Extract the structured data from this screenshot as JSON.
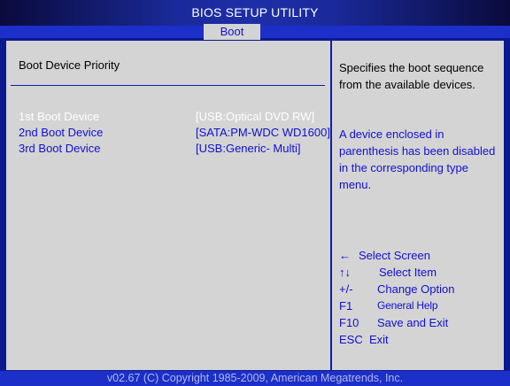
{
  "header": {
    "title": "BIOS SETUP UTILITY"
  },
  "tabs": [
    {
      "label": "Boot",
      "active": true
    }
  ],
  "section": {
    "title": "Boot Device Priority"
  },
  "boot_devices": [
    {
      "label": "1st Boot Device",
      "value": "[USB:Optical DVD RW]",
      "selected": true
    },
    {
      "label": "2nd Boot Device",
      "value": "[SATA:PM-WDC WD1600]",
      "selected": false
    },
    {
      "label": "3rd Boot Device",
      "value": "[USB:Generic- Multi]",
      "selected": false
    }
  ],
  "help": {
    "description": "Specifies the boot sequence from the available devices.",
    "note": "A device enclosed in parenthesis has been disabled in the corresponding type menu."
  },
  "keys": [
    {
      "key": "←",
      "desc": "Select Screen",
      "icon": "left-arrow-icon"
    },
    {
      "key": "↑↓",
      "desc": "Select Item",
      "icon": "up-down-arrows-icon"
    },
    {
      "key": "+/-",
      "desc": "Change Option"
    },
    {
      "key": "F1",
      "desc": "General Help"
    },
    {
      "key": "F10",
      "desc": "Save and Exit"
    },
    {
      "key": "ESC",
      "desc": "Exit"
    }
  ],
  "footer": {
    "text": "v02.67 (C) Copyright 1985-2009, American Megatrends, Inc."
  },
  "colors": {
    "background": "#0b1a8f",
    "panel": "#d4d4d4",
    "text_blue": "#1010d0",
    "selected_text": "#ffffff",
    "footer_bar": "#1c2fc9"
  }
}
